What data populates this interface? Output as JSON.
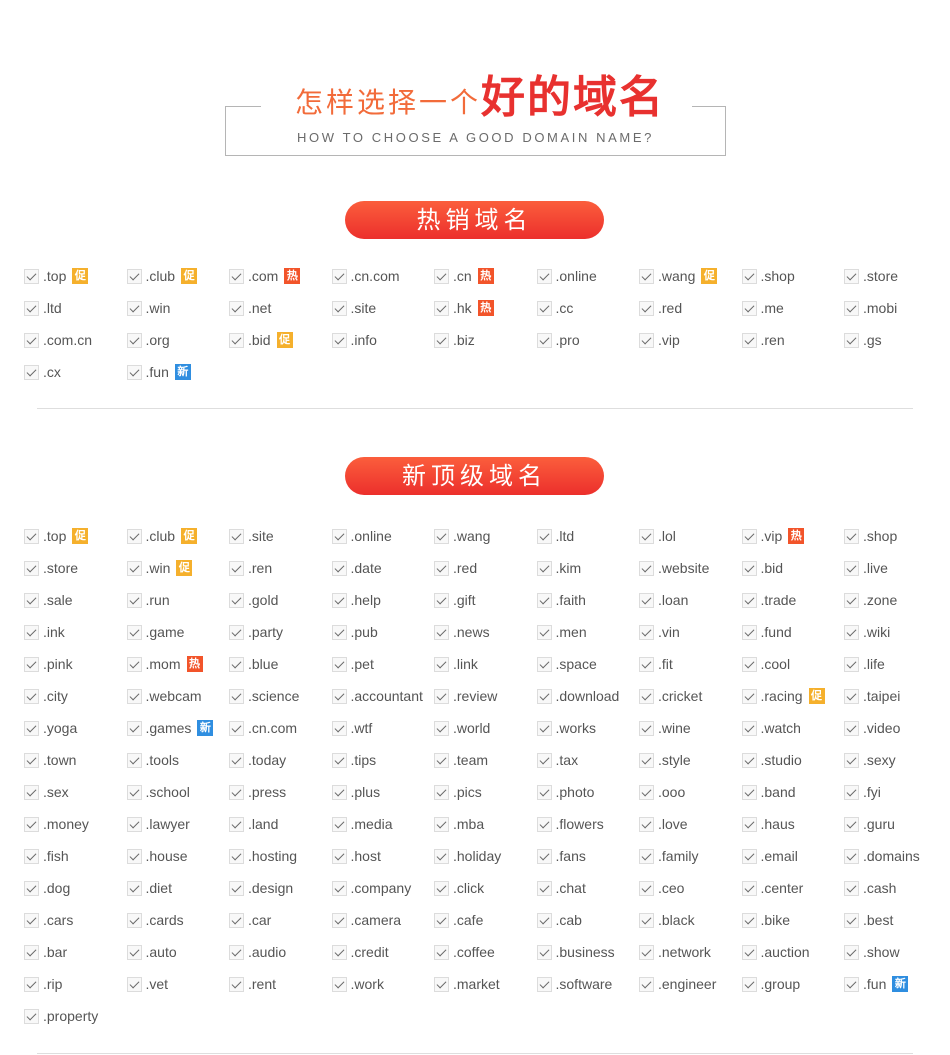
{
  "hero": {
    "title_light": "怎样选择一个",
    "title_bold": "好的域名",
    "subtitle": "HOW TO CHOOSE A GOOD DOMAIN NAME?"
  },
  "badges": {
    "promo": {
      "text": "促",
      "color": "#f5b02c"
    },
    "hot": {
      "text": "热",
      "color": "#f2542a"
    },
    "new": {
      "text": "新",
      "color": "#2f8ee0"
    }
  },
  "sections": [
    {
      "title": "热销域名",
      "items": [
        {
          "label": ".top",
          "badge": "promo"
        },
        {
          "label": ".club",
          "badge": "promo"
        },
        {
          "label": ".com",
          "badge": "hot"
        },
        {
          "label": ".cn.com"
        },
        {
          "label": ".cn",
          "badge": "hot"
        },
        {
          "label": ".online"
        },
        {
          "label": ".wang",
          "badge": "promo"
        },
        {
          "label": ".shop"
        },
        {
          "label": ".store"
        },
        {
          "label": ".ltd"
        },
        {
          "label": ".win"
        },
        {
          "label": ".net"
        },
        {
          "label": ".site"
        },
        {
          "label": ".hk",
          "badge": "hot"
        },
        {
          "label": ".cc"
        },
        {
          "label": ".red"
        },
        {
          "label": ".me"
        },
        {
          "label": ".mobi"
        },
        {
          "label": ".com.cn"
        },
        {
          "label": ".org"
        },
        {
          "label": ".bid",
          "badge": "promo"
        },
        {
          "label": ".info"
        },
        {
          "label": ".biz"
        },
        {
          "label": ".pro"
        },
        {
          "label": ".vip"
        },
        {
          "label": ".ren"
        },
        {
          "label": ".gs"
        },
        {
          "label": ".cx"
        },
        {
          "label": ".fun",
          "badge": "new"
        }
      ]
    },
    {
      "title": "新顶级域名",
      "items": [
        {
          "label": ".top",
          "badge": "promo"
        },
        {
          "label": ".club",
          "badge": "promo"
        },
        {
          "label": ".site"
        },
        {
          "label": ".online"
        },
        {
          "label": ".wang"
        },
        {
          "label": ".ltd"
        },
        {
          "label": ".lol"
        },
        {
          "label": ".vip",
          "badge": "hot"
        },
        {
          "label": ".shop"
        },
        {
          "label": ".store"
        },
        {
          "label": ".win",
          "badge": "promo"
        },
        {
          "label": ".ren"
        },
        {
          "label": ".date"
        },
        {
          "label": ".red"
        },
        {
          "label": ".kim"
        },
        {
          "label": ".website"
        },
        {
          "label": ".bid"
        },
        {
          "label": ".live"
        },
        {
          "label": ".sale"
        },
        {
          "label": ".run"
        },
        {
          "label": ".gold"
        },
        {
          "label": ".help"
        },
        {
          "label": ".gift"
        },
        {
          "label": ".faith"
        },
        {
          "label": ".loan"
        },
        {
          "label": ".trade"
        },
        {
          "label": ".zone"
        },
        {
          "label": ".ink"
        },
        {
          "label": ".game"
        },
        {
          "label": ".party"
        },
        {
          "label": ".pub"
        },
        {
          "label": ".news"
        },
        {
          "label": ".men"
        },
        {
          "label": ".vin"
        },
        {
          "label": ".fund"
        },
        {
          "label": ".wiki"
        },
        {
          "label": ".pink"
        },
        {
          "label": ".mom",
          "badge": "hot"
        },
        {
          "label": ".blue"
        },
        {
          "label": ".pet"
        },
        {
          "label": ".link"
        },
        {
          "label": ".space"
        },
        {
          "label": ".fit"
        },
        {
          "label": ".cool"
        },
        {
          "label": ".life"
        },
        {
          "label": ".city"
        },
        {
          "label": ".webcam"
        },
        {
          "label": ".science"
        },
        {
          "label": ".accountant"
        },
        {
          "label": ".review"
        },
        {
          "label": ".download"
        },
        {
          "label": ".cricket"
        },
        {
          "label": ".racing",
          "badge": "promo"
        },
        {
          "label": ".taipei"
        },
        {
          "label": ".yoga"
        },
        {
          "label": ".games",
          "badge": "new"
        },
        {
          "label": ".cn.com"
        },
        {
          "label": ".wtf"
        },
        {
          "label": ".world"
        },
        {
          "label": ".works"
        },
        {
          "label": ".wine"
        },
        {
          "label": ".watch"
        },
        {
          "label": ".video"
        },
        {
          "label": ".town"
        },
        {
          "label": ".tools"
        },
        {
          "label": ".today"
        },
        {
          "label": ".tips"
        },
        {
          "label": ".team"
        },
        {
          "label": ".tax"
        },
        {
          "label": ".style"
        },
        {
          "label": ".studio"
        },
        {
          "label": ".sexy"
        },
        {
          "label": ".sex"
        },
        {
          "label": ".school"
        },
        {
          "label": ".press"
        },
        {
          "label": ".plus"
        },
        {
          "label": ".pics"
        },
        {
          "label": ".photo"
        },
        {
          "label": ".ooo"
        },
        {
          "label": ".band"
        },
        {
          "label": ".fyi"
        },
        {
          "label": ".money"
        },
        {
          "label": ".lawyer"
        },
        {
          "label": ".land"
        },
        {
          "label": ".media"
        },
        {
          "label": ".mba"
        },
        {
          "label": ".flowers"
        },
        {
          "label": ".love"
        },
        {
          "label": ".haus"
        },
        {
          "label": ".guru"
        },
        {
          "label": ".fish"
        },
        {
          "label": ".house"
        },
        {
          "label": ".hosting"
        },
        {
          "label": ".host"
        },
        {
          "label": ".holiday"
        },
        {
          "label": ".fans"
        },
        {
          "label": ".family"
        },
        {
          "label": ".email"
        },
        {
          "label": ".domains"
        },
        {
          "label": ".dog"
        },
        {
          "label": ".diet"
        },
        {
          "label": ".design"
        },
        {
          "label": ".company"
        },
        {
          "label": ".click"
        },
        {
          "label": ".chat"
        },
        {
          "label": ".ceo"
        },
        {
          "label": ".center"
        },
        {
          "label": ".cash"
        },
        {
          "label": ".cars"
        },
        {
          "label": ".cards"
        },
        {
          "label": ".car"
        },
        {
          "label": ".camera"
        },
        {
          "label": ".cafe"
        },
        {
          "label": ".cab"
        },
        {
          "label": ".black"
        },
        {
          "label": ".bike"
        },
        {
          "label": ".best"
        },
        {
          "label": ".bar"
        },
        {
          "label": ".auto"
        },
        {
          "label": ".audio"
        },
        {
          "label": ".credit"
        },
        {
          "label": ".coffee"
        },
        {
          "label": ".business"
        },
        {
          "label": ".network"
        },
        {
          "label": ".auction"
        },
        {
          "label": ".show"
        },
        {
          "label": ".rip"
        },
        {
          "label": ".vet"
        },
        {
          "label": ".rent"
        },
        {
          "label": ".work"
        },
        {
          "label": ".market"
        },
        {
          "label": ".software"
        },
        {
          "label": ".engineer"
        },
        {
          "label": ".group"
        },
        {
          "label": ".fun",
          "badge": "new"
        },
        {
          "label": ".property"
        }
      ]
    }
  ]
}
